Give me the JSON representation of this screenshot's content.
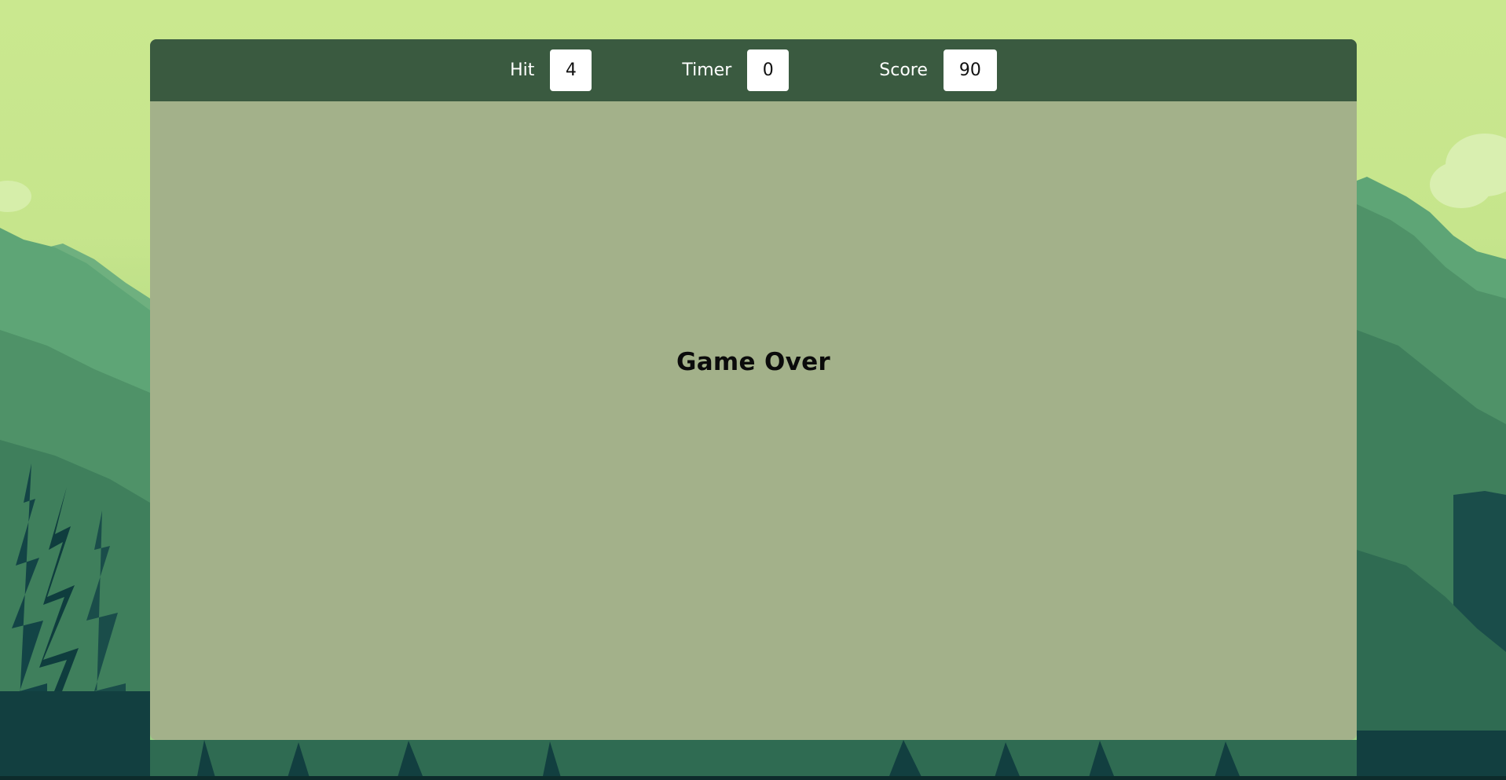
{
  "colors": {
    "sky": "#cae88f",
    "topbar": "#3a5a40",
    "game_area": "#a3b18a",
    "value_box": "#ffffff",
    "text_light": "#ffffff",
    "text_dark": "#0b0b0b"
  },
  "background": {
    "scene": "forest-mountains-illustration"
  },
  "topbar": {
    "hit": {
      "label": "Hit",
      "value": "4"
    },
    "timer": {
      "label": "Timer",
      "value": "0"
    },
    "score": {
      "label": "Score",
      "value": "90"
    }
  },
  "game": {
    "status_text": "Game Over"
  }
}
